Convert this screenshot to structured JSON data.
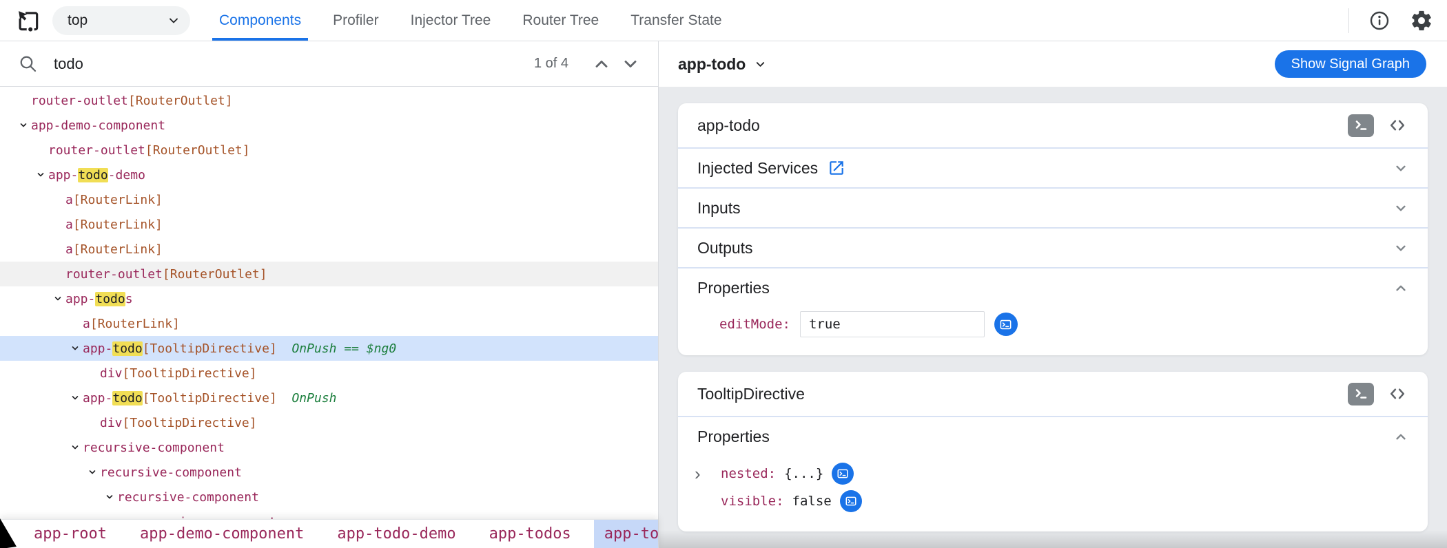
{
  "colors": {
    "accent_blue": "#1a73e8",
    "selected_row_bg": "#d2e3fc",
    "hovered_row_bg": "#f1f1f1",
    "search_highlight_bg": "#f1de55",
    "element_name": "#99275a",
    "directive_name": "#a55328",
    "change_detection_meta": "#1b7e3c",
    "breadcrumb_selected_bg": "#c6d8f8",
    "panel_bg": "#e8eaed",
    "tab_inactive": "#5f6368"
  },
  "icons": {
    "inspect_target": "picker-square-with-cursor",
    "frame_dropdown": "chevron-down",
    "info": "circle-i",
    "settings": "gear",
    "search": "magnifier",
    "prev_match": "chevron-up",
    "next_match": "chevron-down",
    "tree_expand": "chevron-down",
    "terminal": ">_",
    "code": "<>",
    "external_link": "open-in-new",
    "nested_expand": "›"
  },
  "topbar": {
    "frame_selector": {
      "value": "top"
    },
    "tabs": [
      {
        "label": "Components",
        "active": true
      },
      {
        "label": "Profiler",
        "active": false
      },
      {
        "label": "Injector Tree",
        "active": false
      },
      {
        "label": "Router Tree",
        "active": false
      },
      {
        "label": "Transfer State",
        "active": false
      }
    ]
  },
  "search": {
    "value": "todo",
    "match_counter": "1 of 4"
  },
  "tree": {
    "rows": [
      {
        "indent": 1,
        "expandable": false,
        "segments": [
          {
            "kind": "el",
            "text": "router-outlet"
          },
          {
            "kind": "dir",
            "text": "[RouterOutlet]"
          }
        ]
      },
      {
        "indent": 1,
        "expandable": true,
        "segments": [
          {
            "kind": "el",
            "text": "app-demo-component"
          }
        ]
      },
      {
        "indent": 2,
        "expandable": false,
        "segments": [
          {
            "kind": "el",
            "text": "router-outlet"
          },
          {
            "kind": "dir",
            "text": "[RouterOutlet]"
          }
        ]
      },
      {
        "indent": 2,
        "expandable": true,
        "segments": [
          {
            "kind": "el",
            "text": "app-"
          },
          {
            "kind": "hl",
            "text": "todo"
          },
          {
            "kind": "el",
            "text": "-demo"
          }
        ]
      },
      {
        "indent": 3,
        "expandable": false,
        "segments": [
          {
            "kind": "el",
            "text": "a"
          },
          {
            "kind": "dir",
            "text": "[RouterLink]"
          }
        ]
      },
      {
        "indent": 3,
        "expandable": false,
        "segments": [
          {
            "kind": "el",
            "text": "a"
          },
          {
            "kind": "dir",
            "text": "[RouterLink]"
          }
        ]
      },
      {
        "indent": 3,
        "expandable": false,
        "segments": [
          {
            "kind": "el",
            "text": "a"
          },
          {
            "kind": "dir",
            "text": "[RouterLink]"
          }
        ]
      },
      {
        "indent": 3,
        "expandable": false,
        "state": "hover",
        "segments": [
          {
            "kind": "el",
            "text": "router-outlet"
          },
          {
            "kind": "dir",
            "text": "[RouterOutlet]"
          }
        ]
      },
      {
        "indent": 3,
        "expandable": true,
        "segments": [
          {
            "kind": "el",
            "text": "app-"
          },
          {
            "kind": "hl",
            "text": "todo"
          },
          {
            "kind": "el",
            "text": "s"
          }
        ]
      },
      {
        "indent": 4,
        "expandable": false,
        "segments": [
          {
            "kind": "el",
            "text": "a"
          },
          {
            "kind": "dir",
            "text": "[RouterLink]"
          }
        ]
      },
      {
        "indent": 4,
        "expandable": true,
        "state": "selected",
        "segments": [
          {
            "kind": "el",
            "text": "app-"
          },
          {
            "kind": "hl",
            "text": "todo"
          },
          {
            "kind": "dir",
            "text": "[TooltipDirective]"
          },
          {
            "kind": "meta",
            "text": "  OnPush == $ng0"
          }
        ]
      },
      {
        "indent": 5,
        "expandable": false,
        "segments": [
          {
            "kind": "el",
            "text": "div"
          },
          {
            "kind": "dir",
            "text": "[TooltipDirective]"
          }
        ]
      },
      {
        "indent": 4,
        "expandable": true,
        "segments": [
          {
            "kind": "el",
            "text": "app-"
          },
          {
            "kind": "hl",
            "text": "todo"
          },
          {
            "kind": "dir",
            "text": "[TooltipDirective]"
          },
          {
            "kind": "meta",
            "text": "  OnPush"
          }
        ]
      },
      {
        "indent": 5,
        "expandable": false,
        "segments": [
          {
            "kind": "el",
            "text": "div"
          },
          {
            "kind": "dir",
            "text": "[TooltipDirective]"
          }
        ]
      },
      {
        "indent": 4,
        "expandable": true,
        "segments": [
          {
            "kind": "el",
            "text": "recursive-component"
          }
        ]
      },
      {
        "indent": 5,
        "expandable": true,
        "segments": [
          {
            "kind": "el",
            "text": "recursive-component"
          }
        ]
      },
      {
        "indent": 6,
        "expandable": true,
        "segments": [
          {
            "kind": "el",
            "text": "recursive-component"
          }
        ]
      },
      {
        "indent": 7,
        "expandable": true,
        "segments": [
          {
            "kind": "el",
            "text": "recursive-component"
          }
        ]
      }
    ]
  },
  "breadcrumbs": {
    "items": [
      {
        "label": "app-root",
        "selected": false
      },
      {
        "label": "app-demo-component",
        "selected": false
      },
      {
        "label": "app-todo-demo",
        "selected": false
      },
      {
        "label": "app-todos",
        "selected": false
      },
      {
        "label": "app-todo",
        "selected": true
      }
    ]
  },
  "inspector": {
    "header": {
      "selected_component": "app-todo",
      "show_signal_graph_label": "Show Signal Graph"
    },
    "component_card": {
      "title": "app-todo",
      "injected_services_label": "Injected Services",
      "inputs_label": "Inputs",
      "outputs_label": "Outputs",
      "properties_label": "Properties",
      "properties": [
        {
          "name": "editMode:",
          "value": "true"
        }
      ]
    },
    "directive_card": {
      "title": "TooltipDirective",
      "properties_label": "Properties",
      "properties": [
        {
          "name": "nested:",
          "value": "{...}",
          "expandable": true
        },
        {
          "name": "visible:",
          "value": "false",
          "expandable": false
        }
      ]
    }
  }
}
